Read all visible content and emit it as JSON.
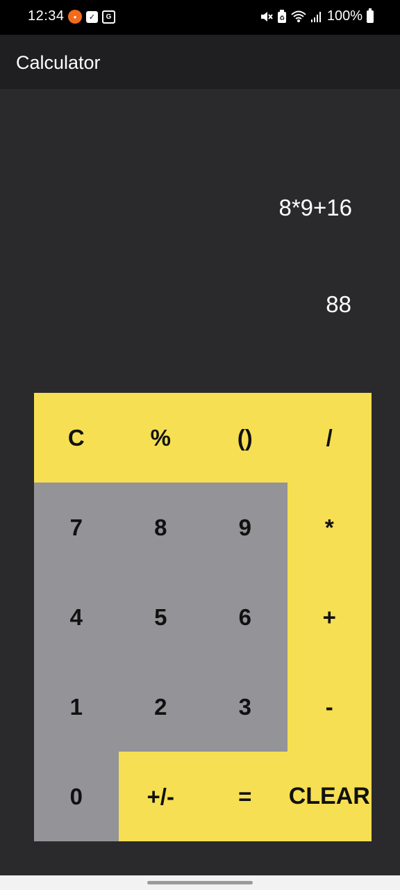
{
  "status_bar": {
    "time": "12:34",
    "battery_text": "100%"
  },
  "app_bar": {
    "title": "Calculator"
  },
  "display": {
    "expression": "8*9+16",
    "result": "88"
  },
  "keypad": {
    "keys": [
      {
        "label": "C"
      },
      {
        "label": "%"
      },
      {
        "label": "()"
      },
      {
        "label": "/"
      },
      {
        "label": "7"
      },
      {
        "label": "8"
      },
      {
        "label": "9"
      },
      {
        "label": "*"
      },
      {
        "label": "4"
      },
      {
        "label": "5"
      },
      {
        "label": "6"
      },
      {
        "label": "+"
      },
      {
        "label": "1"
      },
      {
        "label": "2"
      },
      {
        "label": "3"
      },
      {
        "label": "-"
      },
      {
        "label": "0"
      },
      {
        "label": "+/-"
      },
      {
        "label": "="
      },
      {
        "label": "CLEAR"
      }
    ]
  },
  "colors": {
    "key_yellow": "#f6df52",
    "key_gray": "#939398",
    "background": "#2a2a2c"
  }
}
